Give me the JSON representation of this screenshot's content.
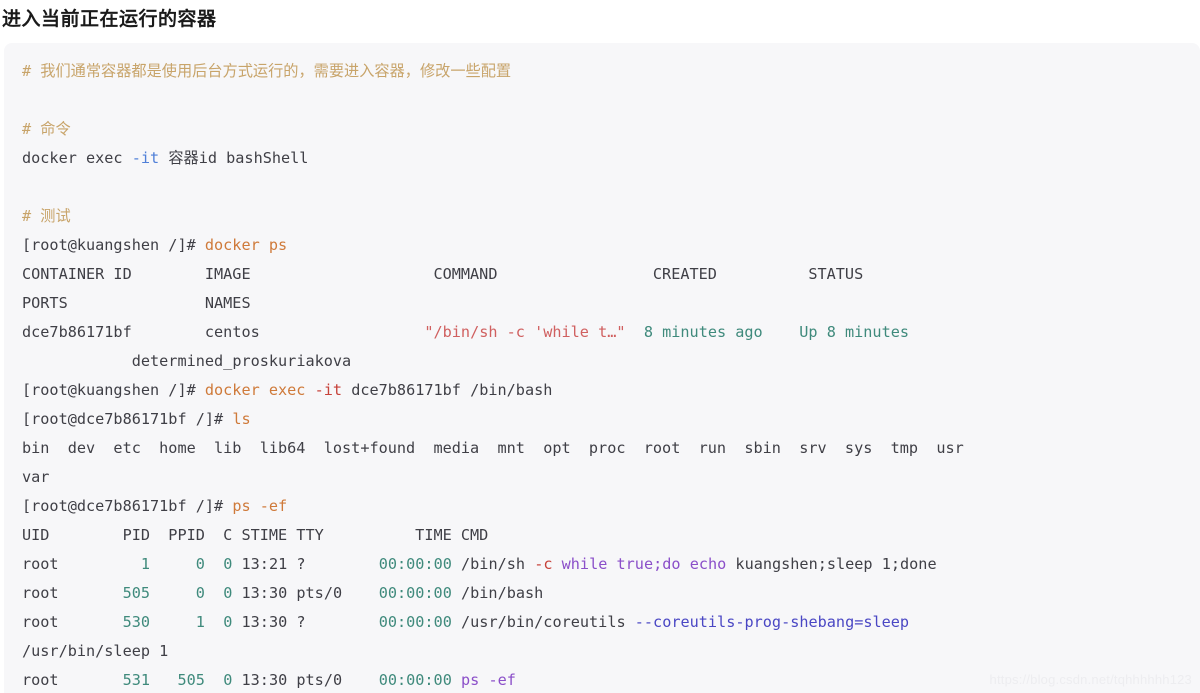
{
  "page": {
    "title": "进入当前正在运行的容器",
    "watermark": "https://blog.csdn.net/tqhhhhhh123",
    "background": "#ffffff",
    "code_background": "#f7f7f9"
  },
  "colors": {
    "comment": "#c8a46a",
    "option_blue": "#4f7fd8",
    "command_orange": "#cf7a3a",
    "option_red": "#c7423a",
    "string_salmon": "#d06060",
    "number_teal": "#3f8a7c",
    "keyword_purple": "#8b4fc9",
    "flag_indigo": "#4a47c4",
    "plain_text": "#3f3f46",
    "title_text": "#1a1a1a"
  },
  "code": {
    "comment_intro": "# 我们通常容器都是使用后台方式运行的，需要进入容器，修改一些配置",
    "comment_command": "# 命令",
    "comment_test": "# 测试",
    "syntax_docker": "docker exec",
    "syntax_it_flag": "-it",
    "syntax_args": "容器id bashShell",
    "prompt_host": "[root@kuangshen /]# ",
    "prompt_container": "[root@dce7b86171bf /]# ",
    "cmd_docker_ps": "docker ps",
    "cmd_docker_exec": "docker exec",
    "cmd_exec_flag": "-it",
    "cmd_exec_args": "dce7b86171bf /bin/bash",
    "cmd_ls": "ls",
    "cmd_ps": "ps",
    "cmd_ps_flag": "-ef"
  },
  "docker_ps": {
    "headers_row1": "CONTAINER ID        IMAGE                    COMMAND                 CREATED          STATUS",
    "headers_row2": "PORTS               NAMES",
    "header_container_id": "CONTAINER ID",
    "header_image": "IMAGE",
    "header_command": "COMMAND",
    "header_created": "CREATED",
    "header_status": "STATUS",
    "header_ports": "PORTS",
    "header_names": "NAMES",
    "row": {
      "container_id": "dce7b86171bf",
      "image": "centos",
      "command": "\"/bin/sh -c 'while t…\"",
      "created": "8 minutes ago",
      "status": "Up 8 minutes",
      "names": "determined_proskuriakova"
    }
  },
  "ls_output": {
    "line1": "bin  dev  etc  home  lib  lib64  lost+found  media  mnt  opt  proc  root  run  sbin  srv  sys  tmp  usr",
    "line2": "var",
    "entries": [
      "bin",
      "dev",
      "etc",
      "home",
      "lib",
      "lib64",
      "lost+found",
      "media",
      "mnt",
      "opt",
      "proc",
      "root",
      "run",
      "sbin",
      "srv",
      "sys",
      "tmp",
      "usr",
      "var"
    ]
  },
  "ps_output": {
    "header": "UID        PID  PPID  C STIME TTY          TIME CMD",
    "header_uid": "UID",
    "header_pid": "PID",
    "header_ppid": "PPID",
    "header_c": "C",
    "header_stime": "STIME",
    "header_tty": "TTY",
    "header_time": "TIME",
    "header_cmd": "CMD",
    "rows": [
      {
        "uid": "root",
        "pid": "1",
        "ppid": "0",
        "c": "0",
        "stime": "13:21",
        "tty": "?",
        "time": "00:00:00",
        "cmd_path": "/bin/sh",
        "cmd_flag": "-c",
        "cmd_kw1": "while",
        "cmd_kw2": "true;do",
        "cmd_kw3": "echo",
        "cmd_rest": "kuangshen;sleep 1;done"
      },
      {
        "uid": "root",
        "pid": "505",
        "ppid": "0",
        "c": "0",
        "stime": "13:30",
        "tty": "pts/0",
        "time": "00:00:00",
        "cmd_path": "/bin/bash"
      },
      {
        "uid": "root",
        "pid": "530",
        "ppid": "1",
        "c": "0",
        "stime": "13:30",
        "tty": "?",
        "time": "00:00:00",
        "cmd_path": "/usr/bin/coreutils",
        "cmd_flag": "--coreutils-prog-shebang=sleep",
        "cmd_wrap": "/usr/bin/sleep 1"
      },
      {
        "uid": "root",
        "pid": "531",
        "ppid": "505",
        "c": "0",
        "stime": "13:30",
        "tty": "pts/0",
        "time": "00:00:00",
        "cmd_path": "ps",
        "cmd_flag": "-ef"
      }
    ]
  }
}
